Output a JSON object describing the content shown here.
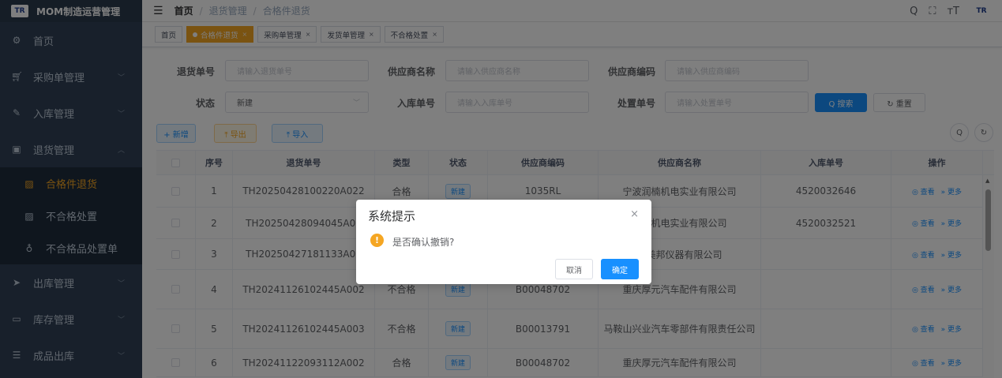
{
  "app": {
    "title": "MOM制造运营管理",
    "logo": "TR"
  },
  "sidebar": {
    "items": [
      {
        "label": "首页",
        "icon": "dashboard-icon",
        "glyph": "⚙"
      },
      {
        "label": "采购单管理",
        "icon": "cart-icon",
        "glyph": "🛒",
        "arrow": "﹀"
      },
      {
        "label": "入库管理",
        "icon": "edit-icon",
        "glyph": "✎",
        "arrow": "﹀"
      },
      {
        "label": "退货管理",
        "icon": "return-icon",
        "glyph": "▣",
        "arrow": "︿"
      }
    ],
    "sub_items": [
      {
        "label": "合格件退货",
        "icon": "doc-icon",
        "glyph": "▨"
      },
      {
        "label": "不合格处置",
        "icon": "doc-icon",
        "glyph": "▨"
      },
      {
        "label": "不合格品处置单",
        "icon": "hand-icon",
        "glyph": "♁"
      }
    ],
    "after_items": [
      {
        "label": "出库管理",
        "icon": "send-icon",
        "glyph": "➤",
        "arrow": "﹀"
      },
      {
        "label": "库存管理",
        "icon": "monitor-icon",
        "glyph": "▭",
        "arrow": "﹀"
      },
      {
        "label": "成品出库",
        "icon": "list-icon",
        "glyph": "☰",
        "arrow": "﹀"
      }
    ]
  },
  "header": {
    "breadcrumb": [
      "首页",
      "退货管理",
      "合格件退货"
    ],
    "sep": "/",
    "icons": [
      "search-icon",
      "fullscreen-icon",
      "font-size-icon"
    ],
    "avatar": "TR"
  },
  "tags": [
    {
      "label": "首页",
      "active": false
    },
    {
      "label": "合格件退货",
      "active": true
    },
    {
      "label": "采购单管理",
      "active": false
    },
    {
      "label": "发货单管理",
      "active": false
    },
    {
      "label": "不合格处置",
      "active": false
    }
  ],
  "search": {
    "return_no": {
      "label": "退货单号",
      "placeholder": "请输入退货单号"
    },
    "supplier_name": {
      "label": "供应商名称",
      "placeholder": "请输入供应商名称"
    },
    "supplier_code": {
      "label": "供应商编码",
      "placeholder": "请输入供应商编码"
    },
    "status": {
      "label": "状态",
      "value": "新建"
    },
    "inbound_no": {
      "label": "入库单号",
      "placeholder": "请输入入库单号"
    },
    "disposal_no": {
      "label": "处置单号",
      "placeholder": "请输入处置单号"
    },
    "search_btn": "Q 搜索",
    "reset_btn": "↻ 重置"
  },
  "toolbar": {
    "add": "+ 新增",
    "export": "⤒ 导出",
    "import": "⤒ 导入"
  },
  "table": {
    "headers": [
      "序号",
      "退货单号",
      "类型",
      "状态",
      "供应商编码",
      "供应商名称",
      "入库单号",
      "操作"
    ],
    "rows": [
      {
        "idx": "1",
        "no": "TH20250428100220A022",
        "type": "合格",
        "status": "新建",
        "code": "1035RL",
        "name": "宁波润楠机电实业有限公司",
        "inbound": "4520032646"
      },
      {
        "idx": "2",
        "no": "TH20250428094045A02",
        "type": "",
        "status": "",
        "code": "",
        "name": "润楠机电实业有限公司",
        "inbound": "4520032521"
      },
      {
        "idx": "3",
        "no": "TH20250427181133A02",
        "type": "",
        "status": "",
        "code": "",
        "name": "市美邦仪器有限公司",
        "inbound": ""
      },
      {
        "idx": "4",
        "no": "TH20241126102445A002",
        "type": "不合格",
        "status": "新建",
        "code": "B00048702",
        "name": "重庆厚元汽车配件有限公司",
        "inbound": ""
      },
      {
        "idx": "5",
        "no": "TH20241126102445A003",
        "type": "不合格",
        "status": "新建",
        "code": "B00013791",
        "name": "马鞍山兴业汽车零部件有限责任公司",
        "inbound": ""
      },
      {
        "idx": "6",
        "no": "TH20241122093112A002",
        "type": "合格",
        "status": "新建",
        "code": "B00048702",
        "name": "重庆厚元汽车配件有限公司",
        "inbound": ""
      }
    ],
    "op_view": "◎ 查看",
    "op_more": "» 更多"
  },
  "dialog": {
    "title": "系统提示",
    "message": "是否确认撤销?",
    "cancel": "取消",
    "confirm": "确定",
    "close": "×",
    "warn": "!"
  },
  "colors": {
    "sidebar": "#304156",
    "accent": "#f5a623",
    "primary": "#1890ff"
  }
}
